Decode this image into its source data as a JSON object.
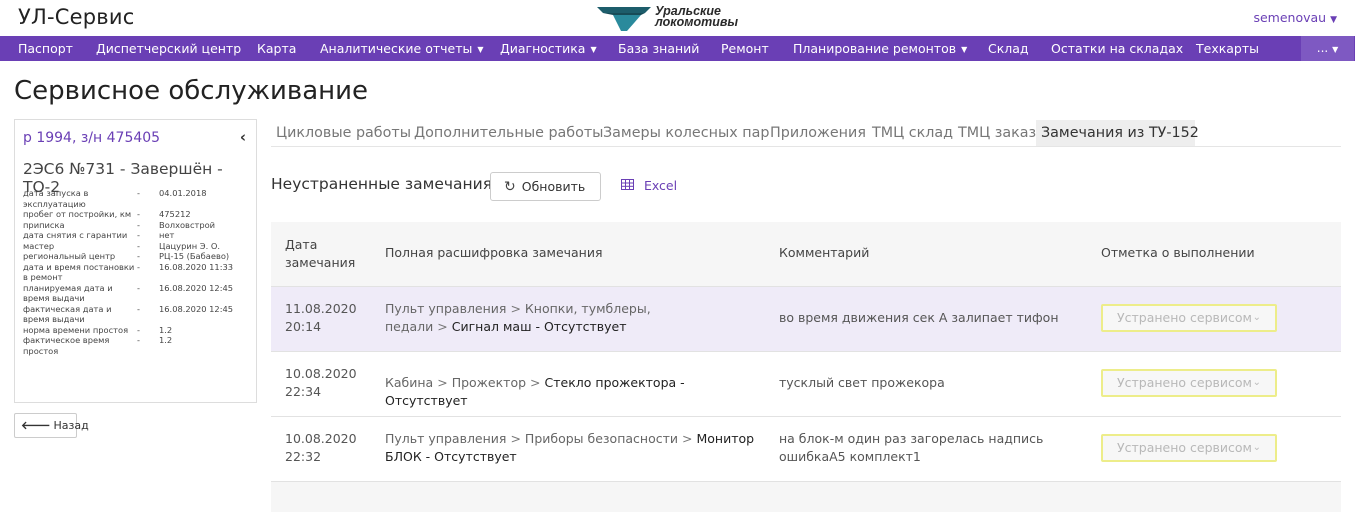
{
  "app": {
    "title": "УЛ-Сервис",
    "user": "semenovau",
    "logo_line1": "Уральские",
    "logo_line2": "локомотивы"
  },
  "nav": {
    "items": [
      {
        "label": "Паспорт",
        "caret": false
      },
      {
        "label": "Диспетчерский центр",
        "caret": false
      },
      {
        "label": "Карта",
        "caret": false
      },
      {
        "label": "Аналитические отчеты",
        "caret": true
      },
      {
        "label": "Диагностика",
        "caret": true
      },
      {
        "label": "База знаний",
        "caret": false
      },
      {
        "label": "Ремонт",
        "caret": false
      },
      {
        "label": "Планирование ремонтов",
        "caret": true
      },
      {
        "label": "Склад",
        "caret": false
      },
      {
        "label": "Остатки на складах",
        "caret": false
      },
      {
        "label": "Техкарты",
        "caret": false
      }
    ],
    "more": "..."
  },
  "page": {
    "title": "Сервисное обслуживание"
  },
  "card": {
    "link": "р 1994, з/н 475405",
    "subtitle": "2ЭС6 №731 - Завершён - ТО-2",
    "dash": "-",
    "rows": [
      {
        "k": "дата запуска в эксплуатацию",
        "v": "04.01.2018"
      },
      {
        "k": "пробег от постройки, км",
        "v": "475212"
      },
      {
        "k": "приписка",
        "v": "Волховстрой"
      },
      {
        "k": "дата снятия с гарантии",
        "v": "нет"
      },
      {
        "k": "мастер",
        "v": "Цацурин Э. О."
      },
      {
        "k": "региональный центр",
        "v": "РЦ-15 (Бабаево)"
      },
      {
        "k": "дата и время постановки в ремонт",
        "v": "16.08.2020 11:33"
      },
      {
        "k": "планируемая дата и время выдачи",
        "v": "16.08.2020 12:45"
      },
      {
        "k": "фактическая дата и время выдачи",
        "v": "16.08.2020 12:45"
      },
      {
        "k": "норма времени простоя",
        "v": "1.2"
      },
      {
        "k": "фактическое время простоя",
        "v": "1.2"
      }
    ]
  },
  "back": {
    "label": "Назад"
  },
  "tabs": [
    {
      "label": "Цикловые работы",
      "active": false
    },
    {
      "label": "Дополнительные работы",
      "active": false
    },
    {
      "label": "Замеры колесных пар",
      "active": false
    },
    {
      "label": "Приложения",
      "active": false
    },
    {
      "label": "ТМЦ склад",
      "active": false
    },
    {
      "label": "ТМЦ заказ",
      "active": false
    },
    {
      "label": "Замечания из ТУ-152",
      "active": true
    }
  ],
  "section": {
    "title": "Неустраненные замечания",
    "refresh": "Обновить",
    "excel": "Excel"
  },
  "table": {
    "headers": {
      "date": [
        "Дата",
        "замечания"
      ],
      "desc": "Полная расшифровка замечания",
      "comment": "Комментарий",
      "mark": "Отметка о выполнении"
    },
    "rows": [
      {
        "date": "11.08.2020",
        "time": "20:14",
        "path": [
          "Пульт управления",
          "Кнопки, тумблеры, педали"
        ],
        "last": "Сигнал маш - Отсутствует",
        "comment": "во время движения сек А залипает тифон",
        "status": "Устранено сервисом",
        "highlight": true
      },
      {
        "date": "10.08.2020",
        "time": "22:34",
        "path": [
          "Кабина",
          "Прожектор"
        ],
        "last": "Стекло прожектора - Отсутствует",
        "comment": "тусклый свет прожекора",
        "status": "Устранено сервисом",
        "highlight": false
      },
      {
        "date": "10.08.2020",
        "time": "22:32",
        "path": [
          "Пульт управления",
          "Приборы безопасности"
        ],
        "last": "Монитор БЛОК - Отсутствует",
        "comment": "на блок-м один раз загорелась надпись ошибкаА5 комплект1",
        "status": "Устранено сервисом",
        "highlight": false
      }
    ]
  },
  "colors": {
    "accent": "#6a3fb5",
    "highlight_row": "#efebf8",
    "select_border": "#eded8a"
  }
}
